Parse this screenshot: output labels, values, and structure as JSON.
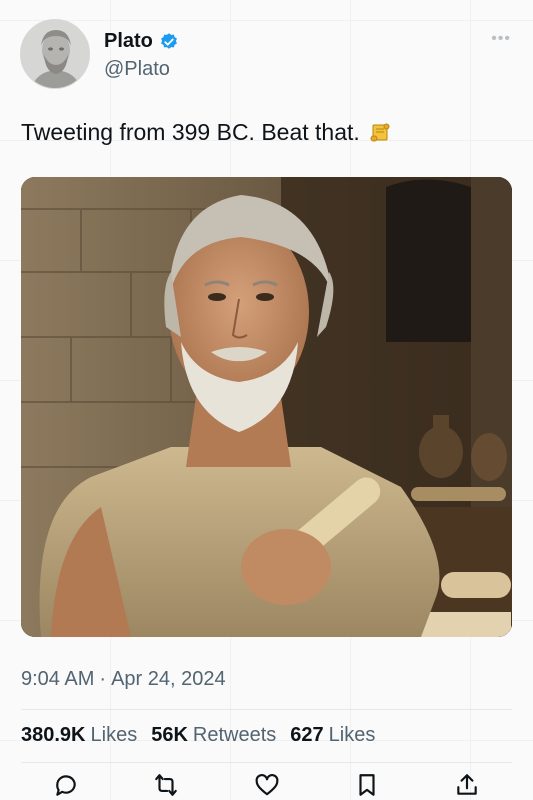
{
  "author": {
    "name": "Plato",
    "handle": "@Plato",
    "verified": true,
    "verified_color": "#1d9bf0"
  },
  "tweet": {
    "text": "Tweeting from 399 BC. Beat that.",
    "emoji": "scroll-emoji",
    "time": "9:04 AM",
    "separator": "·",
    "date": "Apr 24, 2024"
  },
  "stats": [
    {
      "value": "380.9K",
      "label": "Likes"
    },
    {
      "value": "56K",
      "label": "Retweets"
    },
    {
      "value": "627",
      "label": "Likes"
    }
  ],
  "actions": [
    "reply-icon",
    "retweet-icon",
    "like-icon",
    "bookmark-icon",
    "share-icon"
  ],
  "colors": {
    "text": "#0f1419",
    "secondary": "#536471",
    "background": "#fafafa"
  }
}
